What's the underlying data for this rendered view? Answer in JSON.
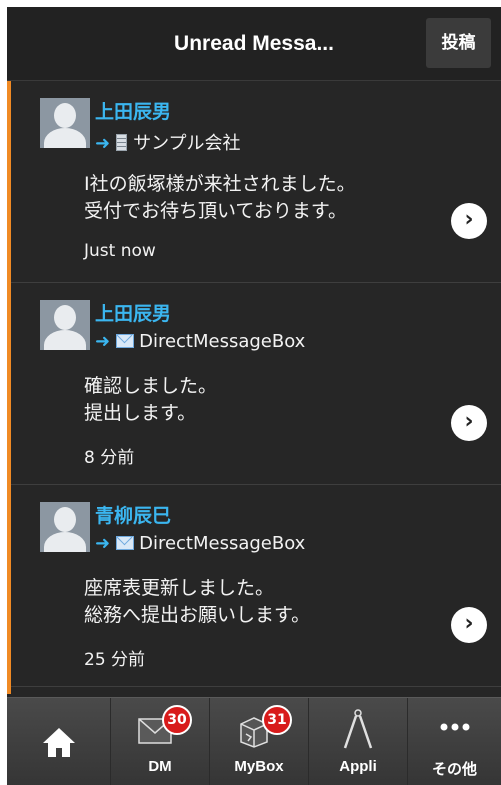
{
  "header": {
    "title": "Unread Messa...",
    "post_label": "投稿"
  },
  "messages": [
    {
      "sender": "上田辰男",
      "destination": "サンプル会社",
      "destination_icon": "building-icon",
      "body": "I社の飯塚様が来社されました。\n受付でお待ち頂いております。",
      "time": "Just now"
    },
    {
      "sender": "上田辰男",
      "destination": "DirectMessageBox",
      "destination_icon": "envelope-icon",
      "body": "確認しました。\n提出します。",
      "time": "8 分前"
    },
    {
      "sender": "青柳辰巳",
      "destination": "DirectMessageBox",
      "destination_icon": "envelope-icon",
      "body": "座席表更新しました。\n総務へ提出お願いします。",
      "time": "25 分前"
    }
  ],
  "nav": {
    "home": {
      "icon": "home-icon"
    },
    "dm": {
      "label": "DM",
      "badge": "30",
      "icon": "envelope-icon"
    },
    "mybox": {
      "label": "MyBox",
      "badge": "31",
      "icon": "box-icon"
    },
    "appli": {
      "label": "Appli",
      "icon": "compass-icon"
    },
    "more": {
      "label": "その他",
      "icon": "more-icon"
    }
  },
  "colors": {
    "accent": "#3bb6f0",
    "stripe": "#f08a24",
    "badge": "#d81b1b"
  }
}
